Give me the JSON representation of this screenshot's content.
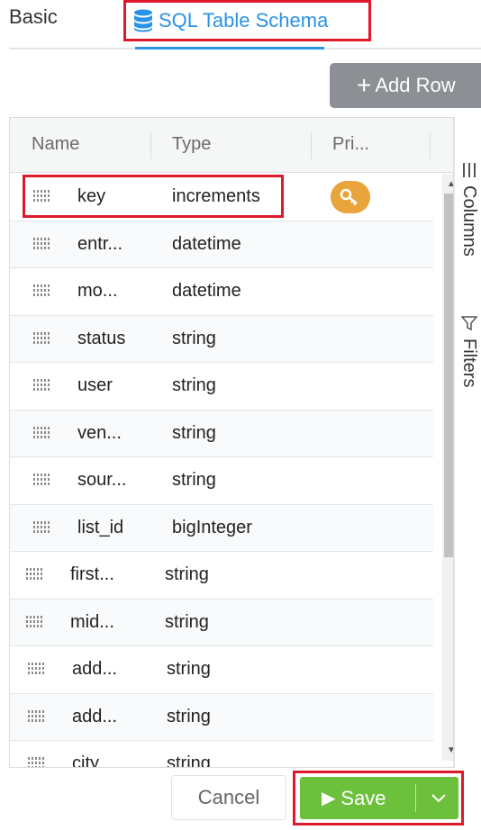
{
  "tabs": {
    "basic_label": "Basic",
    "sql_label": "SQL Table Schema"
  },
  "toolbar": {
    "add_row_label": "Add Row"
  },
  "grid": {
    "columns": [
      "Name",
      "Type",
      "Pri..."
    ],
    "rows": [
      {
        "name": "key",
        "type": "increments",
        "primary": true
      },
      {
        "name": "entr...",
        "type": "datetime",
        "primary": false
      },
      {
        "name": "mo...",
        "type": "datetime",
        "primary": false
      },
      {
        "name": "status",
        "type": "string",
        "primary": false
      },
      {
        "name": "user",
        "type": "string",
        "primary": false
      },
      {
        "name": "ven...",
        "type": "string",
        "primary": false
      },
      {
        "name": "sour...",
        "type": "string",
        "primary": false
      },
      {
        "name": "list_id",
        "type": "bigInteger",
        "primary": false
      },
      {
        "name": "first...",
        "type": "string",
        "primary": false
      },
      {
        "name": "mid...",
        "type": "string",
        "primary": false
      },
      {
        "name": "add...",
        "type": "string",
        "primary": false
      },
      {
        "name": "add...",
        "type": "string",
        "primary": false
      },
      {
        "name": "city",
        "type": "string",
        "primary": false
      }
    ]
  },
  "side_panel": {
    "columns_label": "Columns",
    "filters_label": "Filters"
  },
  "footer": {
    "cancel_label": "Cancel",
    "save_label": "Save"
  },
  "colors": {
    "accent_blue": "#2a93e8",
    "save_green": "#6cc03c",
    "highlight_red": "#e0182b",
    "key_orange": "#e9a43b",
    "add_row_gray": "#8c8f93"
  },
  "icons": [
    "database-icon",
    "plus-icon",
    "drag-handle-icon",
    "key-icon",
    "columns-icon",
    "filter-icon",
    "play-icon",
    "chevron-down-icon"
  ]
}
